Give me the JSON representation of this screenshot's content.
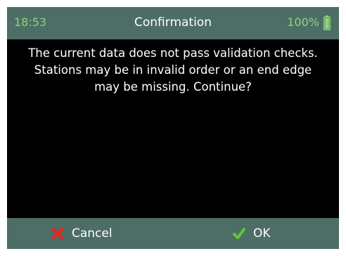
{
  "status_bar": {
    "time": "18:53",
    "title": "Confirmation",
    "battery_percent": "100%",
    "battery_level": 1.0,
    "accent_color": "#8fd47a",
    "bar_color": "#4d6d67"
  },
  "dialog": {
    "message": "The current data does not pass validation checks. Stations may be in invalid order or an end edge may be missing. Continue?"
  },
  "soft_keys": {
    "cancel": {
      "label": "Cancel",
      "icon": "red-x-icon",
      "icon_color": "#e8241d"
    },
    "ok": {
      "label": "OK",
      "icon": "green-check-icon",
      "icon_color": "#5cc83a"
    }
  }
}
